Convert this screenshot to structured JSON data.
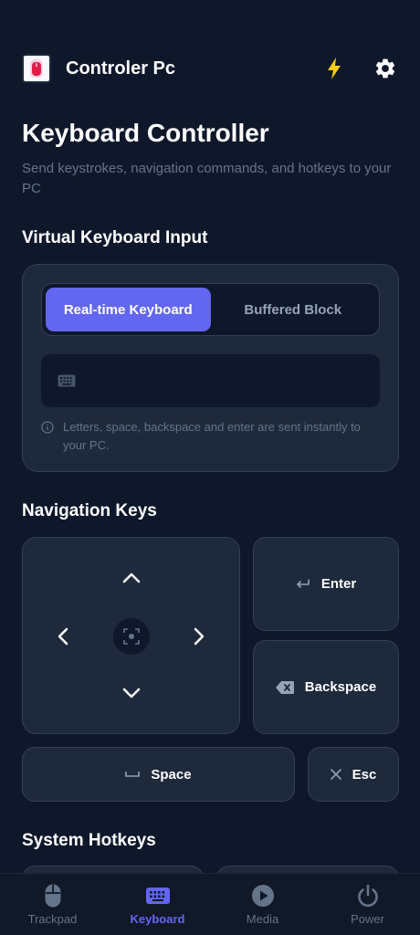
{
  "app": {
    "title": "Controler Pc"
  },
  "page": {
    "title": "Keyboard Controller",
    "subtitle": "Send keystrokes, navigation commands, and hotkeys to your PC"
  },
  "virtual_keyboard": {
    "section_title": "Virtual Keyboard Input",
    "modes": [
      {
        "label": "Real-time Keyboard",
        "active": true
      },
      {
        "label": "Buffered Block",
        "active": false
      }
    ],
    "input": {
      "value": "",
      "placeholder": ""
    },
    "hint": "Letters, space, backspace and enter are sent instantly to your PC."
  },
  "navigation": {
    "section_title": "Navigation Keys",
    "enter_label": "Enter",
    "backspace_label": "Backspace",
    "space_label": "Space",
    "esc_label": "Esc"
  },
  "hotkeys": {
    "section_title": "System Hotkeys"
  },
  "bottom_nav": {
    "items": [
      {
        "label": "Trackpad",
        "icon": "mouse-icon",
        "active": false
      },
      {
        "label": "Keyboard",
        "icon": "keyboard-icon",
        "active": true
      },
      {
        "label": "Media",
        "icon": "play-icon",
        "active": false
      },
      {
        "label": "Power",
        "icon": "power-icon",
        "active": false
      }
    ]
  },
  "colors": {
    "background": "#0f172a",
    "card": "#1e293b",
    "accent": "#6366f1",
    "bolt": "#facc15",
    "muted": "#64748b"
  }
}
